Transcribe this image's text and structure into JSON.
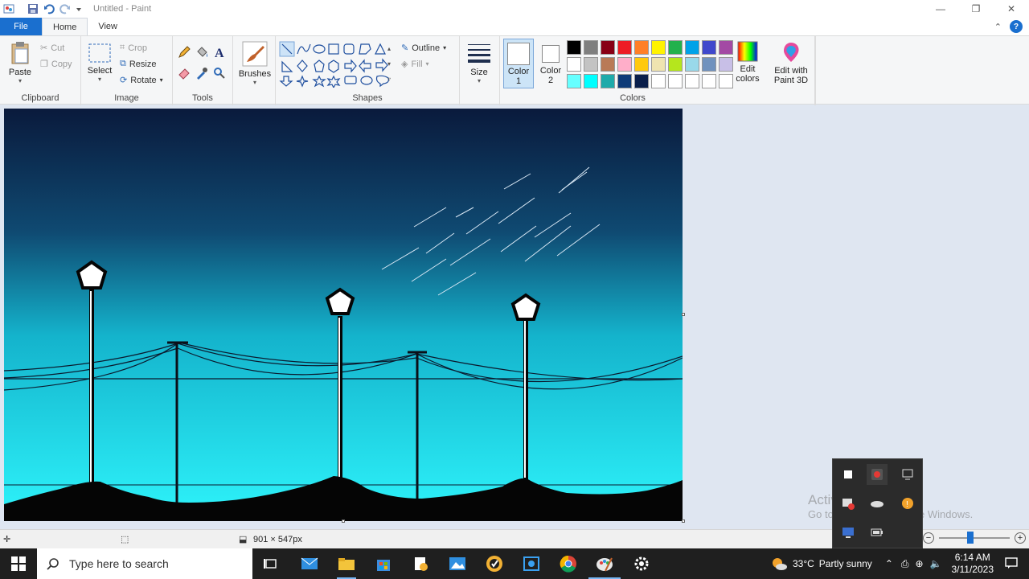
{
  "window": {
    "title": "Untitled - Paint",
    "controls": {
      "minimize": "—",
      "restore": "❐",
      "close": "✕"
    }
  },
  "tabs": {
    "file": "File",
    "home": "Home",
    "view": "View"
  },
  "ribbon": {
    "clipboard": {
      "label": "Clipboard",
      "paste": "Paste",
      "cut": "Cut",
      "copy": "Copy"
    },
    "image": {
      "label": "Image",
      "select": "Select",
      "crop": "Crop",
      "resize": "Resize",
      "rotate": "Rotate"
    },
    "tools": {
      "label": "Tools"
    },
    "brushes": {
      "label": "Brushes"
    },
    "shapes": {
      "label": "Shapes",
      "outline": "Outline",
      "fill": "Fill"
    },
    "size": {
      "label": "Size"
    },
    "colors": {
      "label": "Colors",
      "color1": "Color\n1",
      "color1_l1": "Color",
      "color1_l2": "1",
      "color2_l1": "Color",
      "color2_l2": "2",
      "edit_l1": "Edit",
      "edit_l2": "colors",
      "paint3d_l1": "Edit with",
      "paint3d_l2": "Paint 3D",
      "palette_row1": [
        "#000000",
        "#7f7f7f",
        "#880015",
        "#ed1c24",
        "#ff7f27",
        "#fff200",
        "#22b14c",
        "#00a2e8",
        "#3f48cc",
        "#a349a4"
      ],
      "palette_row2": [
        "#ffffff",
        "#c3c3c3",
        "#b97a57",
        "#ffaec9",
        "#ffc90e",
        "#efe4b0",
        "#b5e61d",
        "#99d9ea",
        "#7092be",
        "#c8bfe7"
      ],
      "palette_row3": [
        "#66ffff",
        "#00ffff",
        "#1eaaaa",
        "#0e3b78",
        "#0a1f4a",
        "#ffffff",
        "#ffffff",
        "#ffffff",
        "#ffffff",
        "#ffffff"
      ]
    }
  },
  "status": {
    "canvas_size": "901 × 547px"
  },
  "taskbar": {
    "search_placeholder": "Type here to search",
    "weather_temp": "33°C",
    "weather_desc": "Partly sunny",
    "time": "6:14 AM",
    "date": "3/11/2023"
  },
  "watermark": {
    "line1": "Activate Windows",
    "line2": "Go to Settings to activate Windows."
  }
}
